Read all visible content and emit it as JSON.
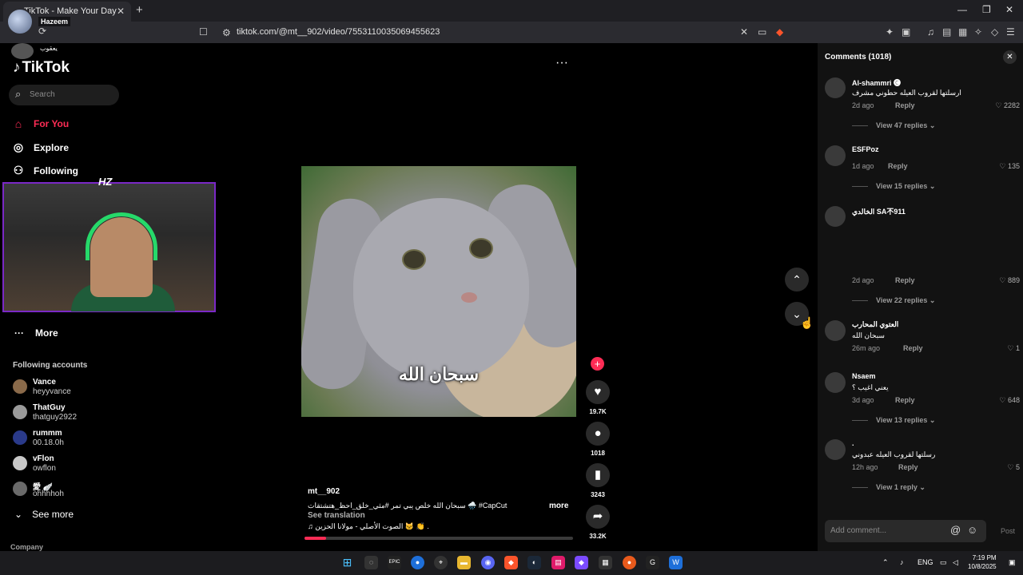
{
  "browser": {
    "tab_title": "TikTok - Make Your Day",
    "url": "tiktok.com/@mt__902/video/7553110035069455623",
    "new_tab": "+"
  },
  "overlay": {
    "streamer_name": "Hazeem",
    "viewer_name": "يعقوب",
    "webcam_badge": "HZ"
  },
  "sidebar": {
    "logo": "TikTok",
    "search_placeholder": "Search",
    "nav": [
      {
        "label": "For You",
        "icon": "home-icon",
        "active": true
      },
      {
        "label": "Explore",
        "icon": "compass-icon",
        "active": false
      },
      {
        "label": "Following",
        "icon": "following-icon",
        "active": false
      }
    ],
    "more_label": "More",
    "following_title": "Following accounts",
    "accounts": [
      {
        "name": "Vance",
        "handle": "heyyvance",
        "color": "#8a6a4a"
      },
      {
        "name": "ThatGuy",
        "handle": "thatguy2922",
        "color": "#9a9a9a"
      },
      {
        "name": "rummm",
        "handle": "00.18.0h",
        "color": "#2a3a8a"
      },
      {
        "name": "vFlon",
        "handle": "owflon",
        "color": "#c8c8c8"
      },
      {
        "name": "愛 🪽",
        "handle": "ohhhhoh",
        "color": "#6a6a6a"
      }
    ],
    "see_more": "See more",
    "company": "Company"
  },
  "video": {
    "caption": "سبحان الله",
    "author": "mt__902",
    "description": "سبحان الله خلص يبي تمر #مثي_خلق_احظ_هتشتقات 🌧️ #CapCut",
    "more": "more",
    "see_translation": "See translation",
    "sound": "♫ الصوت الأصلي - مولانا الحزين 🐱 👏 .",
    "progress": 0.08
  },
  "actions": {
    "likes": "19.7K",
    "comments": "1018",
    "saves": "3243",
    "shares": "33.2K"
  },
  "comments": {
    "title": "Comments (1018)",
    "items": [
      {
        "user": "Al-shammri 🅒",
        "text": "ارسلتها لقروب العيله حطوني مشرف",
        "time": "2d ago",
        "likes": "2282",
        "replies": "View 47 replies"
      },
      {
        "user": "ESFPoz",
        "text": "",
        "time": "1d ago",
        "likes": "135",
        "replies": "View 15 replies"
      },
      {
        "user": "الخالدي SA不911",
        "text": "",
        "time": "2d ago",
        "likes": "889",
        "replies": "View 22 replies"
      },
      {
        "user": "العتوي المحارب",
        "text": "سبحان الله",
        "time": "26m ago",
        "likes": "1",
        "replies": ""
      },
      {
        "user": "Nsaem",
        "text": "يعني اغيب ؟",
        "time": "3d ago",
        "likes": "648",
        "replies": "View 13 replies"
      },
      {
        "user": ".",
        "text": "رسلتها لقروب العيله عبدوني",
        "time": "12h ago",
        "likes": "5",
        "replies": "View 1 reply"
      }
    ],
    "reply_label": "Reply",
    "add_placeholder": "Add comment...",
    "post": "Post"
  },
  "taskbar": {
    "lang": "ENG",
    "time": "7:19 PM",
    "date": "10/8/2025"
  },
  "colors": {
    "accent": "#fe2c55",
    "panel_bg": "#121212"
  }
}
